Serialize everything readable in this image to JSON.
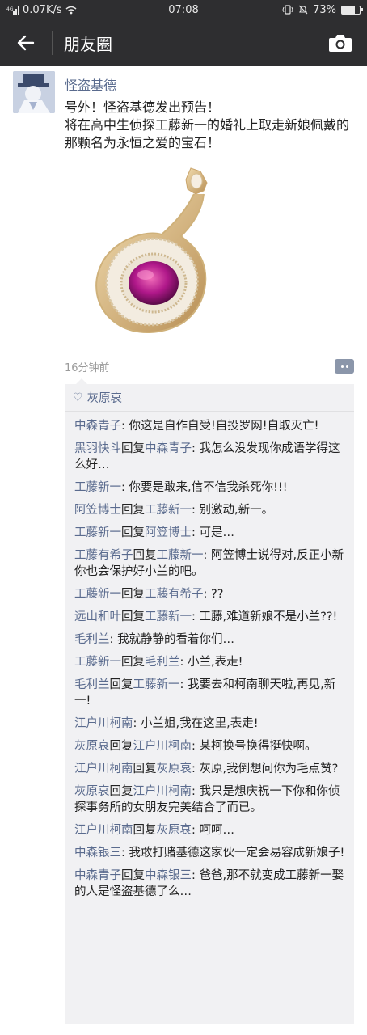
{
  "status_bar": {
    "network": "4G",
    "speed": "0.07K/s",
    "time": "07:08",
    "battery": "73%",
    "battery_level": 0.73
  },
  "nav": {
    "title": "朋友圈"
  },
  "post": {
    "author": "怪盗基德",
    "text_line1": "号外！怪盗基德发出预告！",
    "text_line2": "将在高中生侦探工藤新一的婚礼上取走新娘佩戴的那颗名为永恒之爱的宝石！",
    "time": "16分钟前"
  },
  "likes": {
    "names": "灰原哀"
  },
  "comments": [
    {
      "from": "中森青子",
      "reply_word": "",
      "to": "",
      "text": ": 你这是自作自受!自投罗网!自取灭亡!"
    },
    {
      "from": "黑羽快斗",
      "reply_word": "回复",
      "to": "中森青子",
      "text": ": 我怎么没发现你成语学得这么好…"
    },
    {
      "from": "工藤新一",
      "reply_word": "",
      "to": "",
      "text": ": 你要是敢来,信不信我杀死你!!!"
    },
    {
      "from": "阿笠博士",
      "reply_word": "回复",
      "to": "工藤新一",
      "text": ": 别激动,新一。"
    },
    {
      "from": "工藤新一",
      "reply_word": "回复",
      "to": "阿笠博士",
      "text": ": 可是…"
    },
    {
      "from": "工藤有希子",
      "reply_word": "回复",
      "to": "工藤新一",
      "text": ": 阿笠博士说得对,反正小新你也会保护好小兰的吧。"
    },
    {
      "from": "工藤新一",
      "reply_word": "回复",
      "to": "工藤有希子",
      "text": ": ??"
    },
    {
      "from": "远山和叶",
      "reply_word": "回复",
      "to": "工藤新一",
      "text": ": 工藤,难道新娘不是小兰??!"
    },
    {
      "from": "毛利兰",
      "reply_word": "",
      "to": "",
      "text": ": 我就静静的看着你们…"
    },
    {
      "from": "工藤新一",
      "reply_word": "回复",
      "to": "毛利兰",
      "text": ": 小兰,表走!"
    },
    {
      "from": "毛利兰",
      "reply_word": "回复",
      "to": "工藤新一",
      "text": ": 我要去和柯南聊天啦,再见,新一!"
    },
    {
      "from": "江户川柯南",
      "reply_word": "",
      "to": "",
      "text": ": 小兰姐,我在这里,表走!"
    },
    {
      "from": "灰原哀",
      "reply_word": "回复",
      "to": "江户川柯南",
      "text": ": 某柯换号换得挺快啊。"
    },
    {
      "from": "江户川柯南",
      "reply_word": "回复",
      "to": "灰原哀",
      "text": ": 灰原,我倒想问你为毛点赞?"
    },
    {
      "from": "灰原哀",
      "reply_word": "回复",
      "to": "江户川柯南",
      "text": ": 我只是想庆祝一下你和你侦探事务所的女朋友完美结合了而已。"
    },
    {
      "from": "江户川柯南",
      "reply_word": "回复",
      "to": "灰原哀",
      "text": ": 呵呵…"
    },
    {
      "from": "中森银三",
      "reply_word": "",
      "to": "",
      "text": ": 我敢打赌基德这家伙一定会易容成新娘子!"
    },
    {
      "from": "中森青子",
      "reply_word": "回复",
      "to": "中森银三",
      "text": ": 爸爸,那不就变成工藤新一娶的人是怪盗基德了么…"
    }
  ],
  "colors": {
    "name_link": "#5a6b8e",
    "nav_bg": "#2e2e30",
    "comment_bg": "#f1f1f3"
  }
}
